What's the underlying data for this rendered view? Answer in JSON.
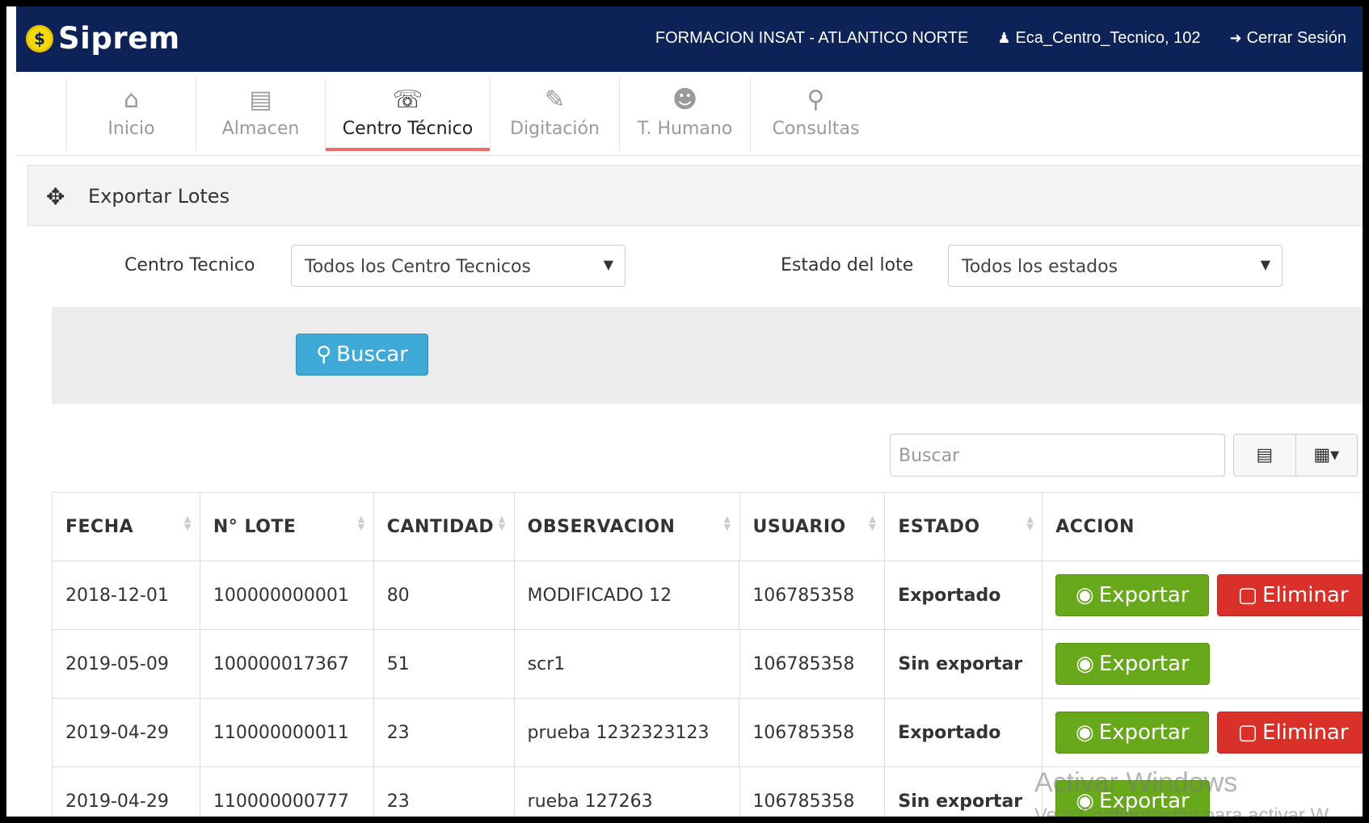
{
  "app": {
    "brand": "Siprem",
    "org": "FORMACION INSAT - ATLANTICO NORTE",
    "user": "Eca_Centro_Tecnico, 102",
    "logout": "Cerrar Sesión"
  },
  "nav": [
    {
      "label": "Inicio",
      "icon": "home-icon"
    },
    {
      "label": "Almacen",
      "icon": "cart-icon"
    },
    {
      "label": "Centro Técnico",
      "icon": "phone-icon",
      "active": true
    },
    {
      "label": "Digitación",
      "icon": "pencil-icon"
    },
    {
      "label": "T. Humano",
      "icon": "users-icon"
    },
    {
      "label": "Consultas",
      "icon": "search-icon"
    }
  ],
  "panel": {
    "title": "Exportar Lotes"
  },
  "filters": {
    "centro_label": "Centro Tecnico",
    "centro_value": "Todos los Centro Tecnicos",
    "estado_label": "Estado del lote",
    "estado_value": "Todos los estados",
    "buscar_label": "Buscar"
  },
  "table_search": {
    "placeholder": "Buscar"
  },
  "table": {
    "columns": [
      "FECHA",
      "N° LOTE",
      "CANTIDAD",
      "OBSERVACION",
      "USUARIO",
      "ESTADO",
      "ACCION"
    ],
    "rows": [
      {
        "fecha": "2018-12-01",
        "lote": "100000000001",
        "cantidad": "80",
        "observacion": "MODIFICADO 12",
        "usuario": "106785358",
        "estado": "Exportado"
      },
      {
        "fecha": "2019-05-09",
        "lote": "100000017367",
        "cantidad": "51",
        "observacion": "scr1",
        "usuario": "106785358",
        "estado": "Sin exportar"
      },
      {
        "fecha": "2019-04-29",
        "lote": "110000000011",
        "cantidad": "23",
        "observacion": "prueba 1232323123",
        "usuario": "106785358",
        "estado": "Exportado"
      },
      {
        "fecha": "2019-04-29",
        "lote": "110000000777",
        "cantidad": "23",
        "observacion": "rueba 127263",
        "usuario": "106785358",
        "estado": "Sin exportar"
      }
    ],
    "export_label": "Exportar",
    "delete_label": "Eliminar"
  },
  "watermark": {
    "line1": "Activar Windows",
    "line2": "Ve a Configuración para activar W"
  },
  "colors": {
    "topbar": "#0d2257",
    "accent": "#f16b6b",
    "primary": "#3fa9d8",
    "success": "#67a91a",
    "danger": "#d9302a"
  }
}
